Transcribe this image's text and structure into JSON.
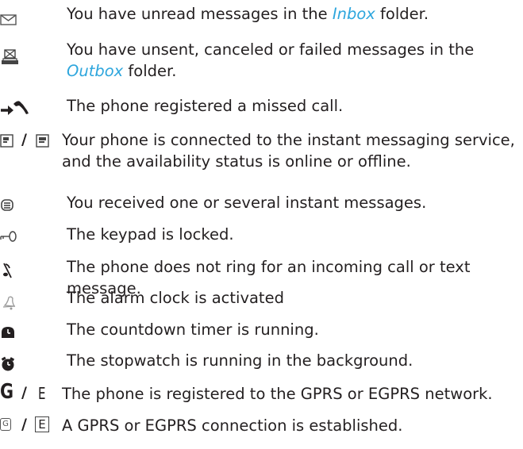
{
  "items": [
    {
      "icon": "envelope-icon",
      "text_before": "You have unread messages in the ",
      "link": "Inbox",
      "text_after": " folder."
    },
    {
      "icon": "outbox-tray-icon",
      "text_before": "You have unsent, canceled or failed messages in the ",
      "link": "Outbox",
      "text_after": " folder."
    },
    {
      "icon": "missed-call-icon",
      "text": "The phone registered a missed call."
    },
    {
      "icon": "instant-messaging-status-icon",
      "separator": "/",
      "text": "Your phone is connected to the instant messaging service, and the availability status is online or offline."
    },
    {
      "icon": "instant-message-received-icon",
      "text": "You received one or several instant messages."
    },
    {
      "icon": "key-icon",
      "text": "The keypad is locked."
    },
    {
      "icon": "silent-note-icon",
      "text": "The phone does not ring for an incoming call or text message."
    },
    {
      "icon": "alarm-bell-icon",
      "text": "The alarm clock is activated"
    },
    {
      "icon": "countdown-timer-icon",
      "text": "The countdown timer is running."
    },
    {
      "icon": "stopwatch-icon",
      "text": "The stopwatch is running in the background."
    },
    {
      "icon": "gprs-registered-icon",
      "glyph_g": "G",
      "separator": "/",
      "glyph_e": "E",
      "text": "The phone is registered to the GPRS or EGPRS network."
    },
    {
      "icon": "gprs-connected-icon",
      "glyph_g": "G",
      "separator": "/",
      "glyph_e": "E",
      "text": "A GPRS or EGPRS connection is established."
    }
  ]
}
